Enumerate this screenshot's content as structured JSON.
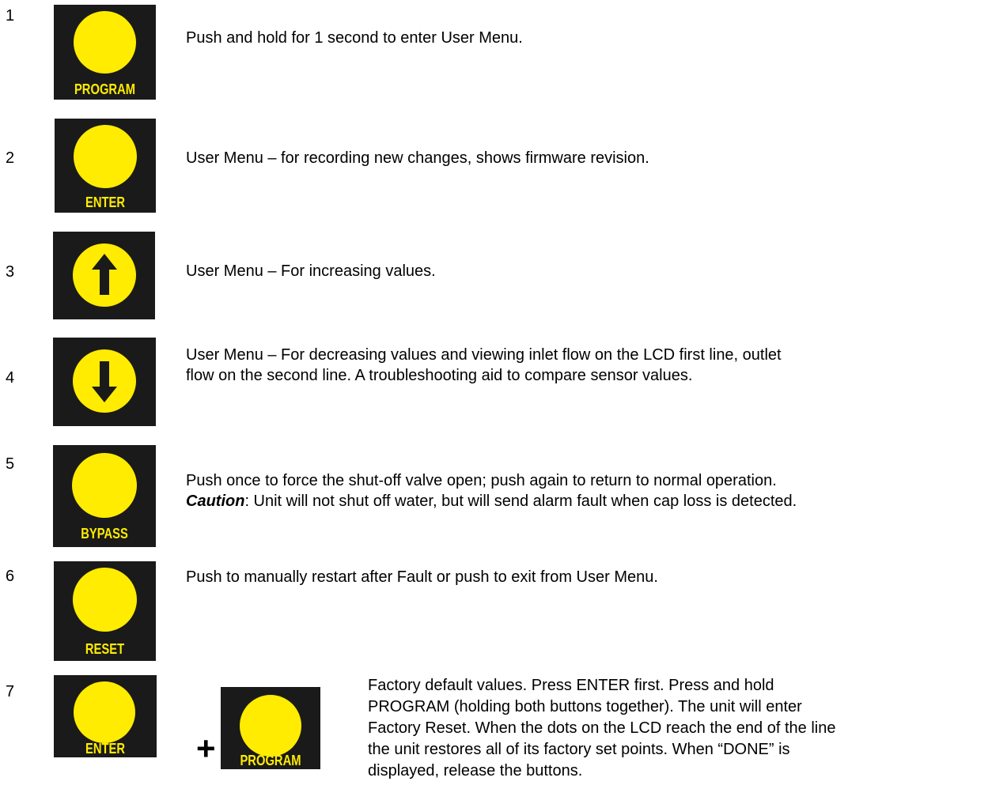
{
  "rows": [
    {
      "number": "1",
      "button_label": "PROGRAM",
      "button_icon": "circle",
      "text": "Push and hold for 1 second to enter User Menu."
    },
    {
      "number": "2",
      "button_label": "ENTER",
      "button_icon": "circle",
      "text": "User Menu – for recording new changes, shows firmware revision."
    },
    {
      "number": "3",
      "button_label": "",
      "button_icon": "arrow-up-icon",
      "text": "User Menu – For increasing values."
    },
    {
      "number": "4",
      "button_label": "",
      "button_icon": "arrow-down-icon",
      "text_line1": "User Menu – For decreasing values and viewing inlet flow on the LCD first line, outlet",
      "text_line2": "flow on the second line. A troubleshooting aid to compare sensor values."
    },
    {
      "number": "5",
      "button_label": "BYPASS",
      "button_icon": "circle",
      "text_line1": "Push once to force the shut-off valve open; push again to return to normal operation.",
      "caution_label": "Caution",
      "text_line2_rest": ": Unit will not shut off water, but will send alarm fault when cap loss is detected."
    },
    {
      "number": "6",
      "button_label": "RESET",
      "button_icon": "circle",
      "text": "Push to manually restart after Fault or push to exit from User Menu."
    },
    {
      "number": "7",
      "button_label": "ENTER",
      "button2_label": "PROGRAM",
      "plus": "+",
      "button_icon": "circle",
      "text_lines": [
        "Factory default values. Press ENTER first. Press and hold",
        "PROGRAM (holding both buttons together). The unit will enter",
        "Factory Reset. When the dots on the LCD reach the end of the line",
        "the unit restores all of its factory set points. When “DONE” is",
        "displayed, release the buttons."
      ]
    }
  ],
  "colors": {
    "button_bg": "#1a1a1a",
    "button_yellow": "#ffec00"
  }
}
